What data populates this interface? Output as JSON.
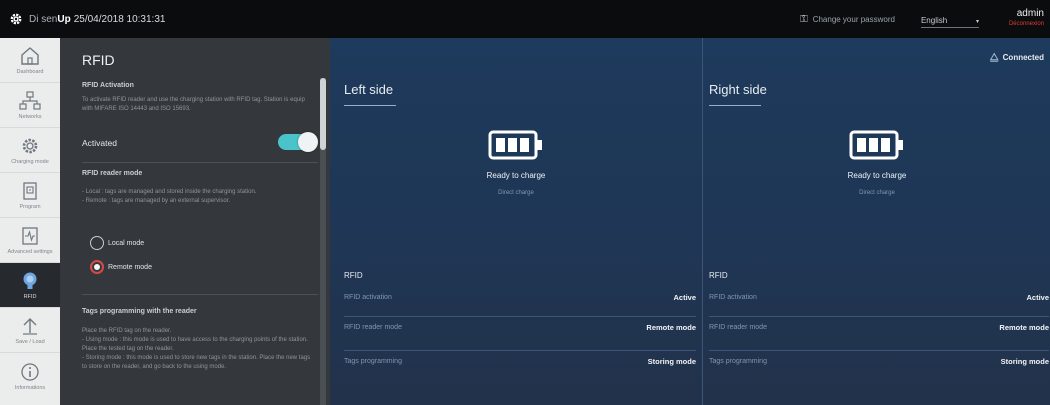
{
  "topbar": {
    "brand_prefix": "Di sen",
    "brand_bold": "Up",
    "datetime": "25/04/2018 10:31:31",
    "password_link": "Change your password",
    "language": "English",
    "user": "admin",
    "logout": "Déconnexion"
  },
  "sidebar": {
    "items": [
      {
        "label": "Dashboard",
        "icon": "home-icon"
      },
      {
        "label": "Networks",
        "icon": "network-icon"
      },
      {
        "label": "Charging mode",
        "icon": "gear-icon"
      },
      {
        "label": "Program",
        "icon": "program-icon"
      },
      {
        "label": "Advanced settings",
        "icon": "advanced-settings-icon"
      },
      {
        "label": "RFID",
        "icon": "rfid-bulb-icon"
      },
      {
        "label": "Save / Load",
        "icon": "upload-arrow-icon"
      },
      {
        "label": "Informations",
        "icon": "info-icon"
      }
    ],
    "active_index": 5
  },
  "panel": {
    "title": "RFID",
    "activation_heading": "RFID Activation",
    "activation_desc": "To activate RFID reader and use the charging station with RFID tag. Station is equip with MIFARE ISO 14443 and ISO 15693.",
    "activated_label": "Activated",
    "activated": true,
    "reader_mode_heading": "RFID reader mode",
    "reader_mode_desc": "- Local : tags are managed and stored inside the charging station.\n- Remote : tags are managed by an external supervisor.",
    "radio_local": "Local mode",
    "radio_remote": "Remote mode",
    "selected_mode": "remote",
    "tags_heading": "Tags programming with the reader",
    "tags_desc": "Place the RFID tag on the reader.\n- Using mode : this mode is used to have access to the charging points of the station. Place the tested tag on the reader.\n- Storing mode : this mode is used to store new tags in the station. Place the new tags to store on the reader, and go back to the using mode."
  },
  "dashboard": {
    "connection": "Connected",
    "left": {
      "title": "Left side",
      "status": "Ready to charge",
      "substatus": "Direct charge",
      "rfid_heading": "RFID",
      "rows": [
        {
          "key": "RFID activation",
          "value": "Active"
        },
        {
          "key": "RFID reader mode",
          "value": "Remote mode"
        },
        {
          "key": "Tags programming",
          "value": "Storing mode"
        }
      ]
    },
    "right": {
      "title": "Right side",
      "status": "Ready to charge",
      "substatus": "Direct charge",
      "rfid_heading": "RFID",
      "rows": [
        {
          "key": "RFID activation",
          "value": "Active"
        },
        {
          "key": "RFID reader mode",
          "value": "Remote mode"
        },
        {
          "key": "Tags programming",
          "value": "Storing mode"
        }
      ]
    }
  },
  "colors": {
    "accent_toggle": "#4bc4c9",
    "radio_selected": "#d84a4a",
    "logout": "#e03b3b",
    "dashboard_bg": "#1f3655"
  }
}
